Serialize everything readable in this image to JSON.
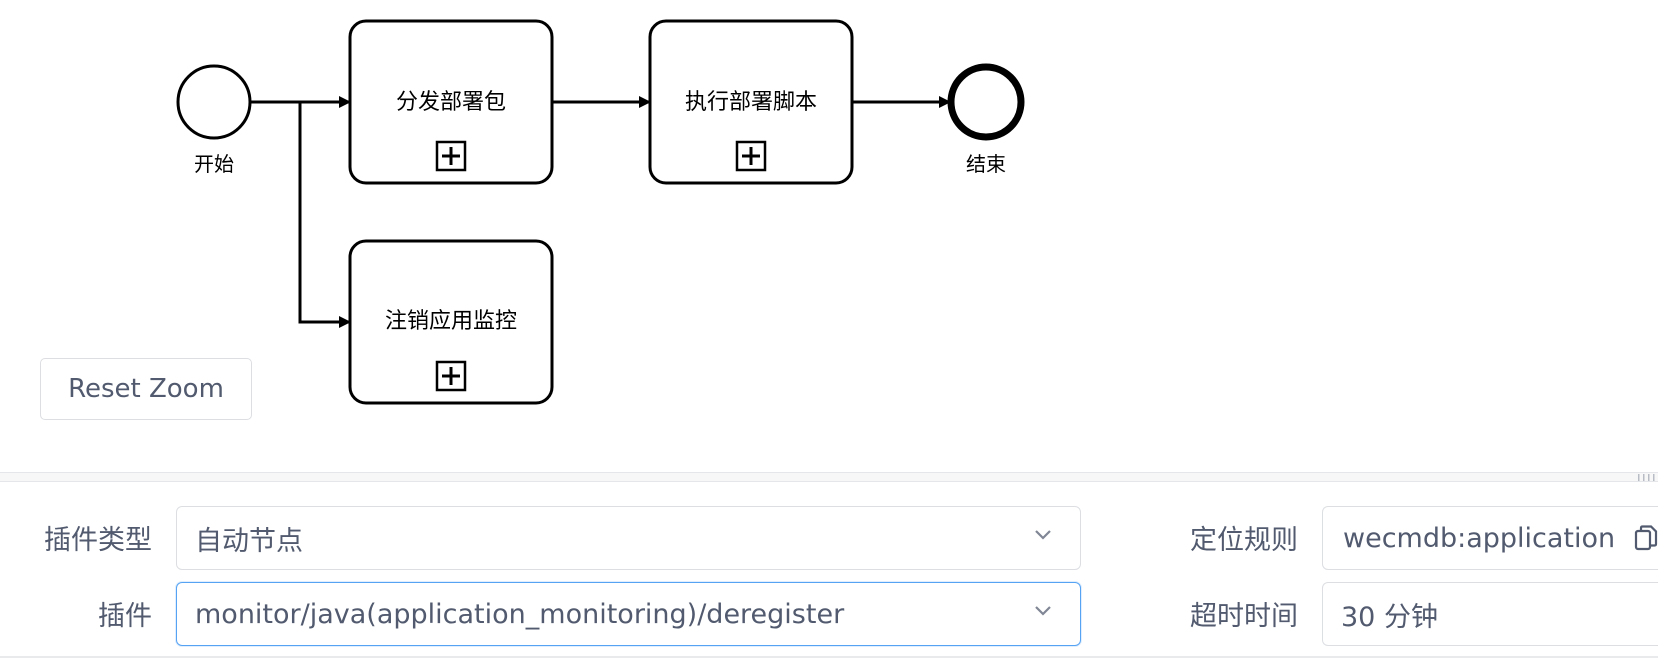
{
  "diagram": {
    "start_event": {
      "label": "开始"
    },
    "end_event": {
      "label": "结束"
    },
    "tasks": [
      {
        "id": "distribute",
        "label": "分发部署包"
      },
      {
        "id": "execute",
        "label": "执行部署脚本"
      },
      {
        "id": "deregister",
        "label": "注销应用监控"
      }
    ]
  },
  "toolbar": {
    "reset_zoom_label": "Reset Zoom"
  },
  "form": {
    "plugin_type": {
      "label": "插件类型",
      "value": "自动节点"
    },
    "plugin": {
      "label": "插件",
      "value": "monitor/java(application_monitoring)/deregister"
    },
    "locate_rule": {
      "label": "定位规则",
      "value": "wecmdb:application"
    },
    "timeout": {
      "label": "超时时间",
      "value": "30 分钟"
    }
  },
  "colors": {
    "stroke": "#000000",
    "input_border": "#dcdee2",
    "focus_border": "#57a3f3",
    "label_text": "#515a6e"
  }
}
